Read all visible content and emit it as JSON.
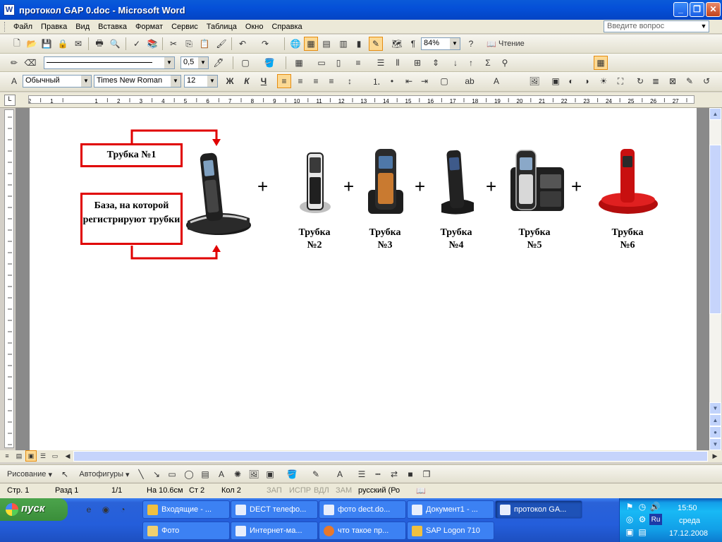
{
  "window": {
    "title": "протокол GAP 0.doc - Microsoft Word",
    "icon_letter": "W"
  },
  "menu": {
    "items": [
      "Файл",
      "Правка",
      "Вид",
      "Вставка",
      "Формат",
      "Сервис",
      "Таблица",
      "Окно",
      "Справка"
    ],
    "help_placeholder": "Введите вопрос"
  },
  "toolbar_standard": {
    "zoom": "84%",
    "read_label": "Чтение"
  },
  "toolbar_drawing": {
    "line_weight": "0,5"
  },
  "toolbar_format": {
    "style": "Обычный",
    "font": "Times New Roman",
    "size": "12",
    "bold": "Ж",
    "italic": "К",
    "underline": "Ч"
  },
  "ruler": {
    "numbers": [
      "2",
      "1",
      "1",
      "2",
      "3",
      "4",
      "5",
      "6",
      "7",
      "8",
      "9",
      "10",
      "11",
      "12",
      "13",
      "14",
      "15",
      "16",
      "17",
      "18",
      "19",
      "20",
      "21",
      "22",
      "23",
      "24",
      "25",
      "26",
      "27"
    ]
  },
  "document": {
    "handset1_label": "Трубка №1",
    "base_label": "База, на которой регистрируют трубки",
    "plus": "+",
    "captions": [
      {
        "line1": "Трубка",
        "line2": "№2"
      },
      {
        "line1": "Трубка",
        "line2": "№3"
      },
      {
        "line1": "Трубка",
        "line2": "№4"
      },
      {
        "line1": "Трубка",
        "line2": "№5"
      },
      {
        "line1": "Трубка",
        "line2": "№6"
      }
    ]
  },
  "drawing": {
    "draw_menu": "Рисование",
    "autoshapes": "Автофигуры"
  },
  "status": {
    "page": "Стр. 1",
    "section": "Разд 1",
    "pages": "1/1",
    "at": "На 10.6см",
    "line": "Ст 2",
    "col": "Кол 2",
    "rec": "ЗАП",
    "trk": "ИСПР",
    "ext": "ВДЛ",
    "ovr": "ЗАМ",
    "lang": "русский (Ро"
  },
  "taskbar": {
    "start": "пуск",
    "tasks_row1": [
      "Входящие - ...",
      "DECT телефо...",
      "фото dect.do...",
      "Документ1 - ...",
      "протокол GA..."
    ],
    "tasks_row2": [
      "Фото",
      "Интернет-ма...",
      "что такое пр...",
      "SAP Logon 710"
    ],
    "clock_time": "15:50",
    "clock_day": "среда",
    "clock_date": "17.12.2008",
    "lang": "Ru"
  },
  "colors": {
    "accent_red": "#e00000",
    "titlebar": "#0550d8",
    "taskbar": "#245edb",
    "start_green": "#3a8e3a"
  }
}
